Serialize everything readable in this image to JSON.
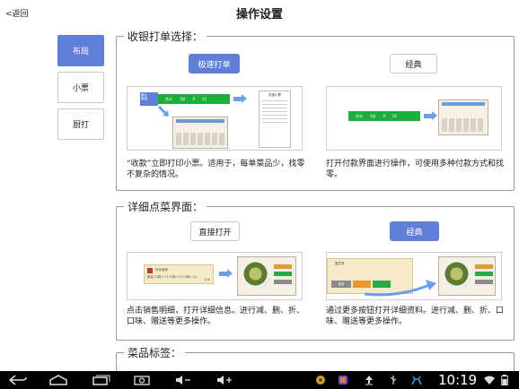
{
  "header": {
    "back_label": "<返回",
    "title": "操作设置"
  },
  "side_tabs": [
    {
      "label": "布局",
      "active": true
    },
    {
      "label": "小票",
      "active": false
    },
    {
      "label": "厨打",
      "active": false
    }
  ],
  "sections": {
    "checkout": {
      "title": "收银打单选择：",
      "options": [
        {
          "label": "极速打单",
          "active": true,
          "description": "“收款”立即打印小票。适用于，每单菜品少，找零不复杂的情况。",
          "preview": {
            "box_label": "单价\n数量",
            "bar_cells": [
              "合计",
              "3份",
              "9",
              "42"
            ],
            "receipt_title": "收银小票"
          }
        },
        {
          "label": "经典",
          "active": false,
          "description": "打开付款界面进行操作，可使用多种付款方式和找零。",
          "preview": {
            "bar_cells": [
              "合计",
              "3份",
              "9",
              "52"
            ]
          }
        }
      ]
    },
    "detail": {
      "title": "详细点菜界面：",
      "options": [
        {
          "label": "直接打开",
          "active": false,
          "description": "点击销售明细，打开详细信息。进行减、删、折、口味、赠送等更多操作。",
          "preview": {
            "card_title": "特色套餐",
            "card_line": "数量  口味(+1)  口味(+2)  口味(+3)",
            "card_price": "¥26"
          }
        },
        {
          "label": "经典",
          "active": true,
          "description": "通过更多按钮打开详细资料。进行减、删、折、口味、赠送等更多操作。",
          "preview": {
            "card_title": "酸豆角",
            "more_label": "更多"
          }
        }
      ]
    },
    "dish_tags": {
      "title": "菜品标签："
    }
  },
  "navbar": {
    "icons": [
      "back-icon",
      "home-icon",
      "recent-apps-icon",
      "screenshot-icon",
      "volume-down-icon",
      "volume-up-icon"
    ],
    "status_icons": [
      "app-icon-1",
      "app-icon-2",
      "upload-icon",
      "usb-icon",
      "android-debug-icon",
      "wifi-icon",
      "battery-icon"
    ],
    "clock": "10:19"
  }
}
